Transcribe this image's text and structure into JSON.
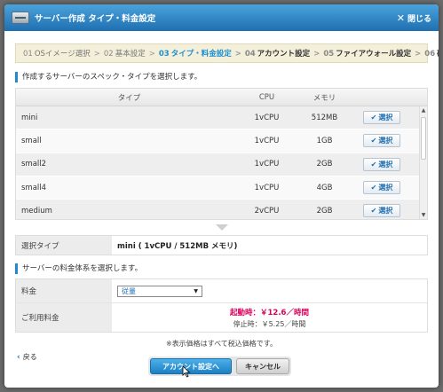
{
  "dialog": {
    "title": "サーバー作成 タイプ・料金設定",
    "close_label": "閉じる"
  },
  "steps": [
    {
      "num": "01",
      "label": "OSイメージ選択",
      "state": "done"
    },
    {
      "num": "02",
      "label": "基本設定",
      "state": "done"
    },
    {
      "num": "03",
      "label": "タイプ・料金設定",
      "state": "active"
    },
    {
      "num": "04",
      "label": "アカウント設定",
      "state": "future"
    },
    {
      "num": "05",
      "label": "ファイアウォール設定",
      "state": "future"
    },
    {
      "num": "06",
      "label": "確認",
      "state": "future"
    }
  ],
  "spec_section": {
    "title": "作成するサーバーのスペック・タイプを選択します。",
    "columns": {
      "type": "タイプ",
      "cpu": "CPU",
      "memory": "メモリ"
    },
    "rows": [
      {
        "type": "mini",
        "cpu": "1vCPU",
        "memory": "512MB",
        "action": "選択"
      },
      {
        "type": "small",
        "cpu": "1vCPU",
        "memory": "1GB",
        "action": "選択"
      },
      {
        "type": "small2",
        "cpu": "1vCPU",
        "memory": "2GB",
        "action": "選択"
      },
      {
        "type": "small4",
        "cpu": "1vCPU",
        "memory": "4GB",
        "action": "選択"
      },
      {
        "type": "medium",
        "cpu": "2vCPU",
        "memory": "2GB",
        "action": "選択"
      }
    ],
    "selected_label": "選択タイプ",
    "selected_value": "mini ( 1vCPU / 512MB メモリ)"
  },
  "pricing_section": {
    "title": "サーバーの料金体系を選択します。",
    "plan_label": "料金",
    "plan_value": "従量",
    "fee_label": "ご利用料金",
    "fee_running": "起動時：￥12.6／時間",
    "fee_stopped": "停止時：￥5.25／時間",
    "note": "※表示価格はすべて税込価格です。"
  },
  "footer": {
    "back_label": "戻る",
    "next_label": "アカウント設定へ",
    "cancel_label": "キャンセル"
  },
  "colors": {
    "accent": "#1f8ad0",
    "price_highlight": "#d7005a"
  }
}
